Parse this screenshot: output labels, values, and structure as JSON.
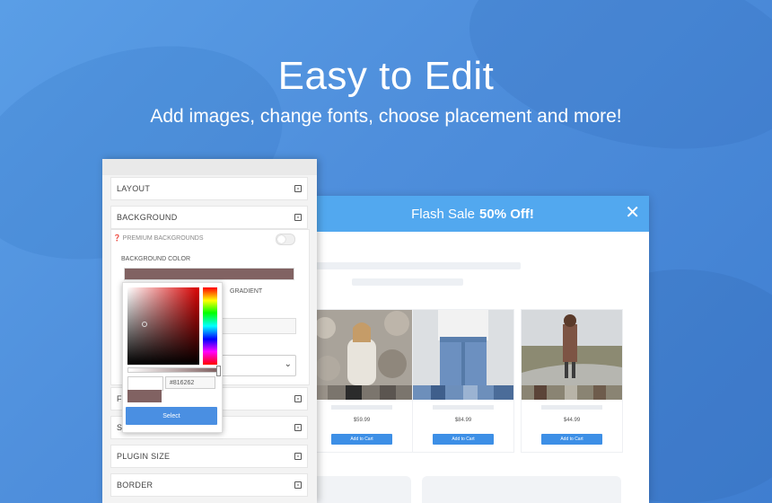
{
  "hero": {
    "title": "Easy to Edit",
    "subtitle": "Add images, change fonts, choose placement and more!"
  },
  "popup": {
    "headline_prefix": "Flash Sale",
    "headline_bold": "50% Off!",
    "close_icon": "close-icon",
    "products": [
      {
        "price": "$59.99",
        "button": "Add to Cart",
        "image": "woman-white-sweater"
      },
      {
        "price": "$84.99",
        "button": "Add to Cart",
        "image": "jeans"
      },
      {
        "price": "$44.99",
        "button": "Add to Cart",
        "image": "woman-poncho-road"
      }
    ],
    "header_color": "#52a8ef",
    "button_color": "#3d8fe6"
  },
  "editor": {
    "sections": {
      "layout": "LAYOUT",
      "background": "BACKGROUND",
      "fonts_partial": "F",
      "second_partial": "S",
      "plugin_size": "PLUGIN SIZE",
      "border": "BORDER"
    },
    "premium_backgrounds": "PREMIUM BACKGROUNDS",
    "background_color_label": "BACKGROUND COLOR",
    "gradient_label": "GRADIENT",
    "color_picker": {
      "hex_value": "#816262",
      "select_label": "Select",
      "current_color": "#816262"
    }
  }
}
